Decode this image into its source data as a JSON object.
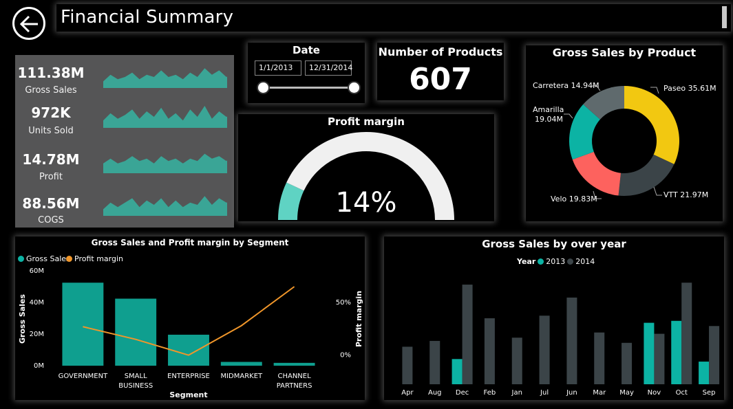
{
  "header": {
    "title": "Financial Summary",
    "back_icon": "arrow-left-icon"
  },
  "kpis": [
    {
      "value": "111.38M",
      "label": "Gross Sales",
      "spark": [
        3,
        6,
        4,
        5,
        7,
        4,
        6,
        5,
        8,
        5,
        6,
        4,
        7,
        5,
        9,
        6,
        8,
        5,
        7,
        10
      ]
    },
    {
      "value": "972K",
      "label": "Units Sold",
      "spark": [
        4,
        8,
        5,
        7,
        10,
        5,
        9,
        6,
        11,
        5,
        8,
        4,
        10,
        6,
        12,
        5,
        9,
        6,
        8,
        11
      ]
    },
    {
      "value": "14.78M",
      "label": "Profit",
      "spark": [
        4,
        6,
        4,
        5,
        7,
        5,
        6,
        4,
        7,
        5,
        6,
        4,
        6,
        5,
        8,
        6,
        7,
        5,
        8,
        9
      ]
    },
    {
      "value": "88.56M",
      "label": "COGS",
      "spark": [
        3,
        6,
        4,
        6,
        8,
        4,
        7,
        5,
        8,
        4,
        7,
        4,
        6,
        5,
        9,
        5,
        8,
        6,
        7,
        10
      ]
    }
  ],
  "date_filter": {
    "title": "Date",
    "start": "1/1/2013",
    "end": "12/31/2014"
  },
  "products": {
    "title": "Number of Products",
    "value": "607"
  },
  "profit_margin": {
    "title": "Profit margin",
    "value_text": "14%",
    "fraction": 0.14
  },
  "colors": {
    "teal": "#0cb3a4",
    "teal_bar": "#0f9f8f",
    "orange": "#f0962a",
    "dark_gray": "#3b4448",
    "mid_gray": "#5f6a6d",
    "yellow": "#f2c811",
    "red": "#fd625e",
    "gauge_fill": "#5fd3c3",
    "gauge_track": "#f0f0f0",
    "kpi_bg": "#555556",
    "spark": "#3aa596"
  },
  "chart_data": [
    {
      "type": "pie",
      "title": "Gross Sales by Product",
      "labels": [
        "Paseo 35.61M",
        "VTT 21.97M",
        "Velo 19.83M",
        "Amarilla",
        "19.04M",
        "Carretera 14.94M"
      ],
      "slices": [
        {
          "name": "Paseo",
          "value": 35.61,
          "color": "#f2c811"
        },
        {
          "name": "VTT",
          "value": 21.97,
          "color": "#3b4448"
        },
        {
          "name": "Velo",
          "value": 19.83,
          "color": "#fd625e"
        },
        {
          "name": "Amarilla",
          "value": 19.04,
          "color": "#0cb3a4"
        },
        {
          "name": "Carretera",
          "value": 14.94,
          "color": "#5f6a6d"
        }
      ]
    },
    {
      "type": "bar",
      "title": "Gross Sales and Profit margin by Segment",
      "categories": [
        [
          "GOVERNMENT"
        ],
        [
          "SMALL",
          "BUSINESS"
        ],
        [
          "ENTERPRISE"
        ],
        [
          "MIDMARKET"
        ],
        [
          "CHANNEL",
          "PARTNERS"
        ]
      ],
      "series": [
        {
          "name": "Gross Sales",
          "values": [
            52.5,
            42.4,
            19.6,
            2.4,
            1.8
          ],
          "axis": "left"
        },
        {
          "name": "Profit margin",
          "values": [
            27,
            15,
            0,
            28,
            65
          ],
          "axis": "right"
        }
      ],
      "xlabel": "Segment",
      "ylabel": "Gross Sales",
      "y2label": "Profit margin",
      "y_ticks": [
        "0M",
        "20M",
        "40M",
        "60M"
      ],
      "y2_ticks": [
        "0%",
        "50%"
      ],
      "ylim": [
        0,
        60
      ],
      "y2lim": [
        -10,
        80
      ]
    },
    {
      "type": "bar",
      "title": "Gross Sales by over year",
      "legend_title": "Year",
      "categories": [
        "Apr",
        "Aug",
        "Dec",
        "Feb",
        "Jan",
        "Jul",
        "Jun",
        "Mar",
        "May",
        "Nov",
        "Oct",
        "Sep"
      ],
      "series": [
        {
          "name": "2013",
          "values": [
            0,
            0,
            3.9,
            0,
            0,
            0,
            0,
            0,
            0,
            9.5,
            9.8,
            3.5
          ],
          "color": "#0cb3a4"
        },
        {
          "name": "2014",
          "values": [
            5.8,
            6.7,
            15.4,
            10.2,
            7.2,
            10.6,
            13.4,
            8.0,
            6.4,
            7.8,
            15.7,
            9.0
          ],
          "color": "#3b4448"
        }
      ],
      "ylim": [
        0,
        17
      ]
    }
  ]
}
